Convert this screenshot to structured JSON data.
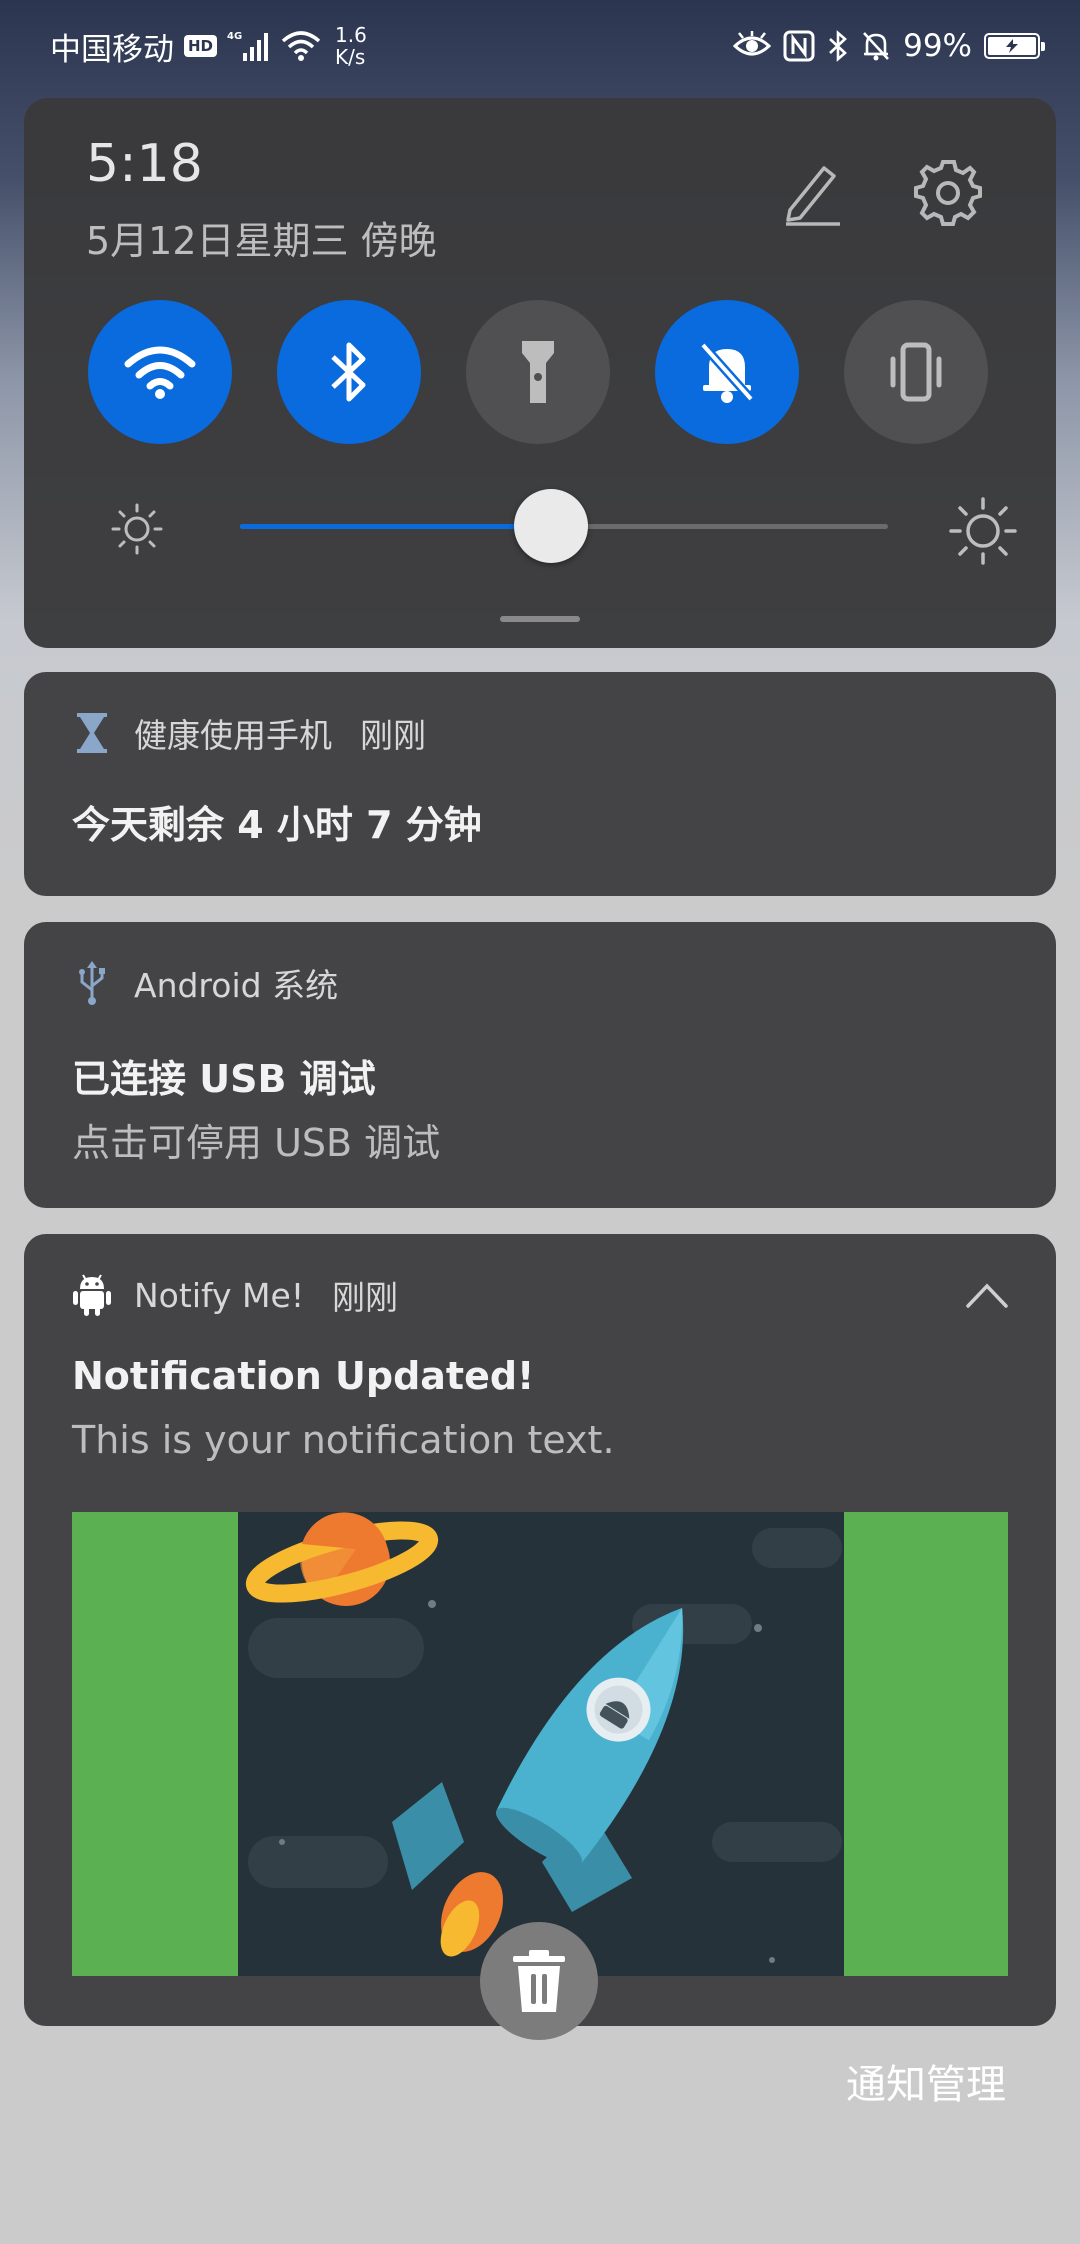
{
  "status_bar": {
    "carrier": "中国移动",
    "hd_label": "HD",
    "network_type": "4G",
    "speed_value": "1.6",
    "speed_unit": "K/s",
    "battery": "99%",
    "icons": [
      "hd-icon",
      "signal-icon",
      "wifi-icon",
      "eye-icon",
      "nfc-icon",
      "bluetooth-icon",
      "mute-icon",
      "battery-charging-icon"
    ]
  },
  "quick_settings": {
    "time": "5:18",
    "date": "5月12日星期三 傍晚",
    "toggles": [
      {
        "name": "wifi",
        "icon": "wifi-icon",
        "state": "on"
      },
      {
        "name": "bluetooth",
        "icon": "bluetooth-icon",
        "state": "on"
      },
      {
        "name": "flashlight",
        "icon": "flashlight-icon",
        "state": "off"
      },
      {
        "name": "silent",
        "icon": "bell-off-icon",
        "state": "on"
      },
      {
        "name": "vibrate",
        "icon": "vibrate-icon",
        "state": "off"
      }
    ],
    "brightness": 0.48,
    "accent_color": "#0a6bde"
  },
  "notifications": [
    {
      "app": "健康使用手机",
      "time": "刚刚",
      "icon": "hourglass-icon",
      "title": "今天剩余 4 小时 7 分钟"
    },
    {
      "app": "Android 系统",
      "icon": "usb-icon",
      "title": "已连接 USB 调试",
      "text": "点击可停用 USB 调试"
    },
    {
      "app": "Notify Me!",
      "time": "刚刚",
      "icon": "android-icon",
      "title": "Notification Updated!",
      "text": "This is your notification text.",
      "image": "rocket-illustration"
    }
  ],
  "actions": {
    "clear_all_icon": "trash-icon",
    "manage_label": "通知管理"
  }
}
